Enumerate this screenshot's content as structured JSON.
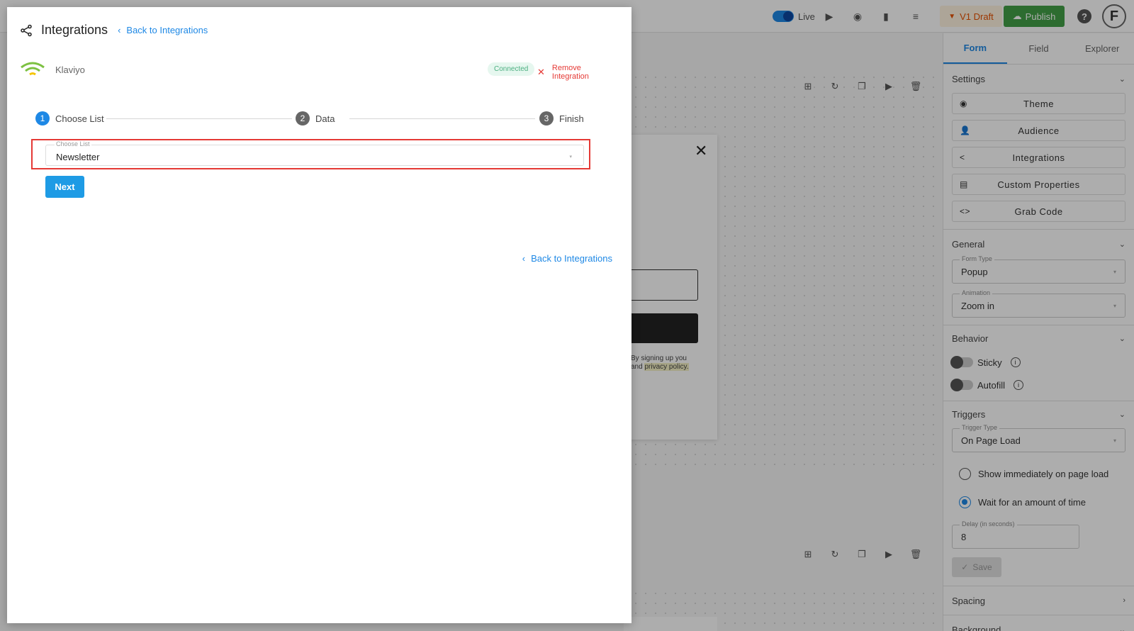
{
  "topbar": {
    "live_label": "Live",
    "draft_label": "V1 Draft",
    "publish_label": "Publish",
    "help_label": "?",
    "avatar_letter": "F"
  },
  "popup_preview": {
    "close_glyph": "✕",
    "consent_text_1": "By signing up you",
    "consent_text_2": "and",
    "privacy_link": "privacy policy."
  },
  "right_panel": {
    "tabs": [
      {
        "label": "Form",
        "active": true
      },
      {
        "label": "Field",
        "active": false
      },
      {
        "label": "Explorer",
        "active": false
      }
    ],
    "settings": {
      "title": "Settings",
      "buttons": [
        {
          "label": "Theme",
          "icon": "palette-icon"
        },
        {
          "label": "Audience",
          "icon": "person-icon"
        },
        {
          "label": "Integrations",
          "icon": "share-icon"
        },
        {
          "label": "Custom Properties",
          "icon": "list-icon"
        },
        {
          "label": "Grab Code",
          "icon": "code-icon"
        }
      ]
    },
    "general": {
      "title": "General",
      "form_type_label": "Form Type",
      "form_type_value": "Popup",
      "animation_label": "Animation",
      "animation_value": "Zoom in"
    },
    "behavior": {
      "title": "Behavior",
      "sticky_label": "Sticky",
      "autofill_label": "Autofill"
    },
    "triggers": {
      "title": "Triggers",
      "trigger_type_label": "Trigger Type",
      "trigger_type_value": "On Page Load",
      "option_immediate": "Show immediately on page load",
      "option_wait": "Wait for an amount of time",
      "delay_label": "Delay (in seconds)",
      "delay_value": "8",
      "save_label": "Save"
    },
    "spacing_title": "Spacing",
    "background_title": "Background"
  },
  "modal": {
    "title": "Integrations",
    "back_label": "Back to Integrations",
    "integration_name": "Klaviyo",
    "status_badge": "Connected",
    "remove_label": "Remove Integration",
    "steps": [
      {
        "num": "1",
        "label": "Choose List",
        "active": true
      },
      {
        "num": "2",
        "label": "Data",
        "active": false
      },
      {
        "num": "3",
        "label": "Finish",
        "active": false
      }
    ],
    "choose_list_label": "Choose List",
    "choose_list_value": "Newsletter",
    "next_label": "Next",
    "back_bottom_label": "Back to Integrations"
  },
  "colors": {
    "accent": "#1e88e5",
    "danger": "#e53935",
    "success": "#43a047",
    "klaviyo": "#7dc142"
  }
}
